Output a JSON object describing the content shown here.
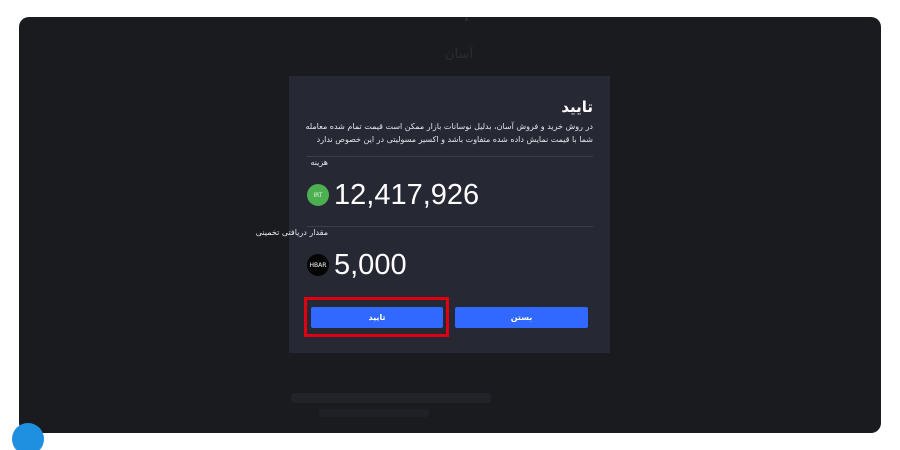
{
  "modal": {
    "title": "تایید",
    "description": "در روش خرید و فروش آسان، بدلیل نوسانات بازار ممکن است قیمت تمام شده معامله شما با قیمت نمایش داده شده متفاوت باشد و اکسیر مسولیتی در این خصوص ندارد",
    "cost_label": "هزینه",
    "cost_currency": "IRT",
    "cost_amount": "12,417,926",
    "receive_label": "مقدار دریافتی تخمینی",
    "receive_currency": "HBAR",
    "receive_amount": "5,000",
    "confirm_label": "تایید",
    "close_label": "بستن"
  },
  "background": {
    "ghost_text": "آسان"
  },
  "colors": {
    "overlay": "#1a1b1f",
    "modal_bg": "#262833",
    "button": "#3168ff",
    "highlight": "#e00012",
    "irt_coin": "#4caf50",
    "hbar_coin": "#050505"
  }
}
